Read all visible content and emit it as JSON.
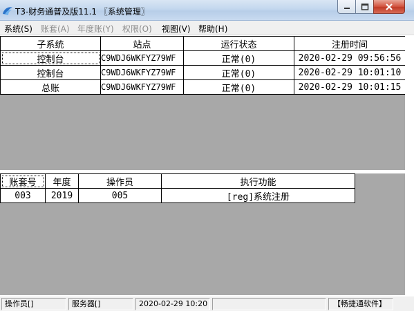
{
  "window": {
    "title": "T3-财务通普及版11.1 〖系统管理〗",
    "app_icon": "app-logo-icon",
    "buttons": {
      "minimize": "minimize-icon",
      "maximize": "maximize-icon",
      "close": "close-icon"
    }
  },
  "menu": {
    "items": [
      {
        "label": "系统(S)",
        "enabled": true
      },
      {
        "label": "账套(A)",
        "enabled": false
      },
      {
        "label": "年度账(Y)",
        "enabled": false
      },
      {
        "label": "权限(O)",
        "enabled": false
      },
      {
        "label": "视图(V)",
        "enabled": true
      },
      {
        "label": "帮助(H)",
        "enabled": true
      }
    ]
  },
  "subsystems": {
    "columns": [
      "子系统",
      "站点",
      "运行状态",
      "注册时间"
    ],
    "rows": [
      [
        "控制台",
        "C9WDJ6WKFYZ79WF",
        "正常(0)",
        "2020-02-29 09:56:56"
      ],
      [
        "控制台",
        "C9WDJ6WKFYZ79WF",
        "正常(0)",
        "2020-02-29 10:01:10"
      ],
      [
        "总账",
        "C9WDJ6WKFYZ79WF",
        "正常(0)",
        "2020-02-29 10:01:15"
      ]
    ]
  },
  "tasks": {
    "columns": [
      "账套号",
      "年度",
      "操作员",
      "执行功能"
    ],
    "rows": [
      [
        "003",
        "2019",
        "005",
        "[reg]系统注册"
      ]
    ]
  },
  "status": {
    "operator": "操作员[]",
    "server": "服务器[]",
    "datetime": "2020-02-29 10:20",
    "brand": "【畅捷通软件】"
  },
  "colors": {
    "pane_background": "#a8a8a8",
    "title_bar": "#c3d7ee",
    "close_button": "#c13b27"
  }
}
